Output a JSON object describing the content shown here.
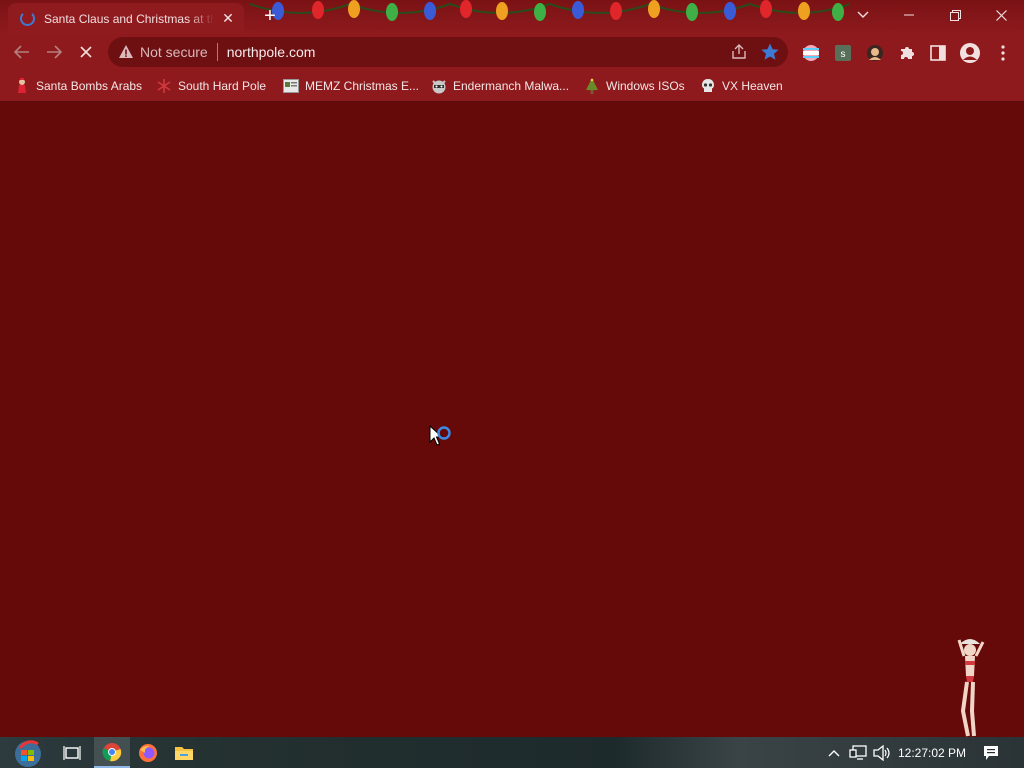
{
  "browser": {
    "tab": {
      "title": "Santa Claus and Christmas at the North Pole",
      "close_glyph": "✕"
    },
    "new_tab_glyph": "+",
    "window_controls": {
      "minimize": "—",
      "restore": "⧉",
      "close": "✕"
    },
    "omnibox": {
      "security_label": "Not secure",
      "url": "northpole.com"
    },
    "extensions": [
      "pride-flag-icon",
      "s-extension-icon",
      "avatar-extension-icon",
      "puzzle-icon",
      "side-panel-icon",
      "profile-icon",
      "kebab-menu-icon"
    ]
  },
  "bookmarks": [
    {
      "label": "Santa Bombs Arabs",
      "icon": "santa-figure-icon"
    },
    {
      "label": "South Hard Pole",
      "icon": "snowflake-icon"
    },
    {
      "label": "MEMZ Christmas E...",
      "icon": "page-thumbnail-icon"
    },
    {
      "label": "Endermanch Malwa...",
      "icon": "raccoon-icon"
    },
    {
      "label": "Windows ISOs",
      "icon": "tree-icon"
    },
    {
      "label": "VX Heaven",
      "icon": "skull-icon"
    }
  ],
  "taskbar": {
    "clock": "12:27:02 PM",
    "apps": [
      "start-orb-icon",
      "task-view-icon",
      "chrome-icon",
      "firefox-icon",
      "file-explorer-icon"
    ]
  },
  "colors": {
    "page_bg": "#650909",
    "chrome_frame": "#8e1a1d",
    "omnibox_bg": "#6e0f12",
    "star_blue": "#3d7ad6"
  }
}
